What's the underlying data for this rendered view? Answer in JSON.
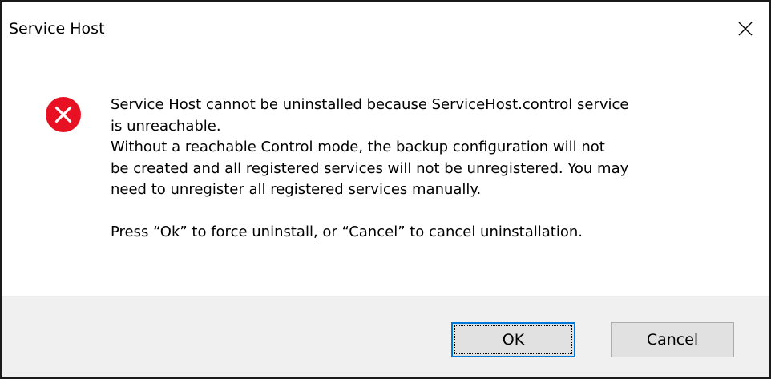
{
  "window": {
    "title": "Service Host",
    "close_icon": "close-icon"
  },
  "message": {
    "icon": "error-icon",
    "icon_color": "#e81123",
    "line1": "Service Host cannot be uninstalled because ServiceHost.control service\nis unreachable.",
    "line2": "Without a reachable Control mode, the backup configuration will not\nbe created and all registered services will not be unregistered. You may\nneed to unregister all registered services manually.",
    "line3": "Press “Ok” to force uninstall, or “Cancel” to cancel uninstallation."
  },
  "buttons": {
    "ok_label": "OK",
    "cancel_label": "Cancel",
    "accent": "#0078d7"
  }
}
